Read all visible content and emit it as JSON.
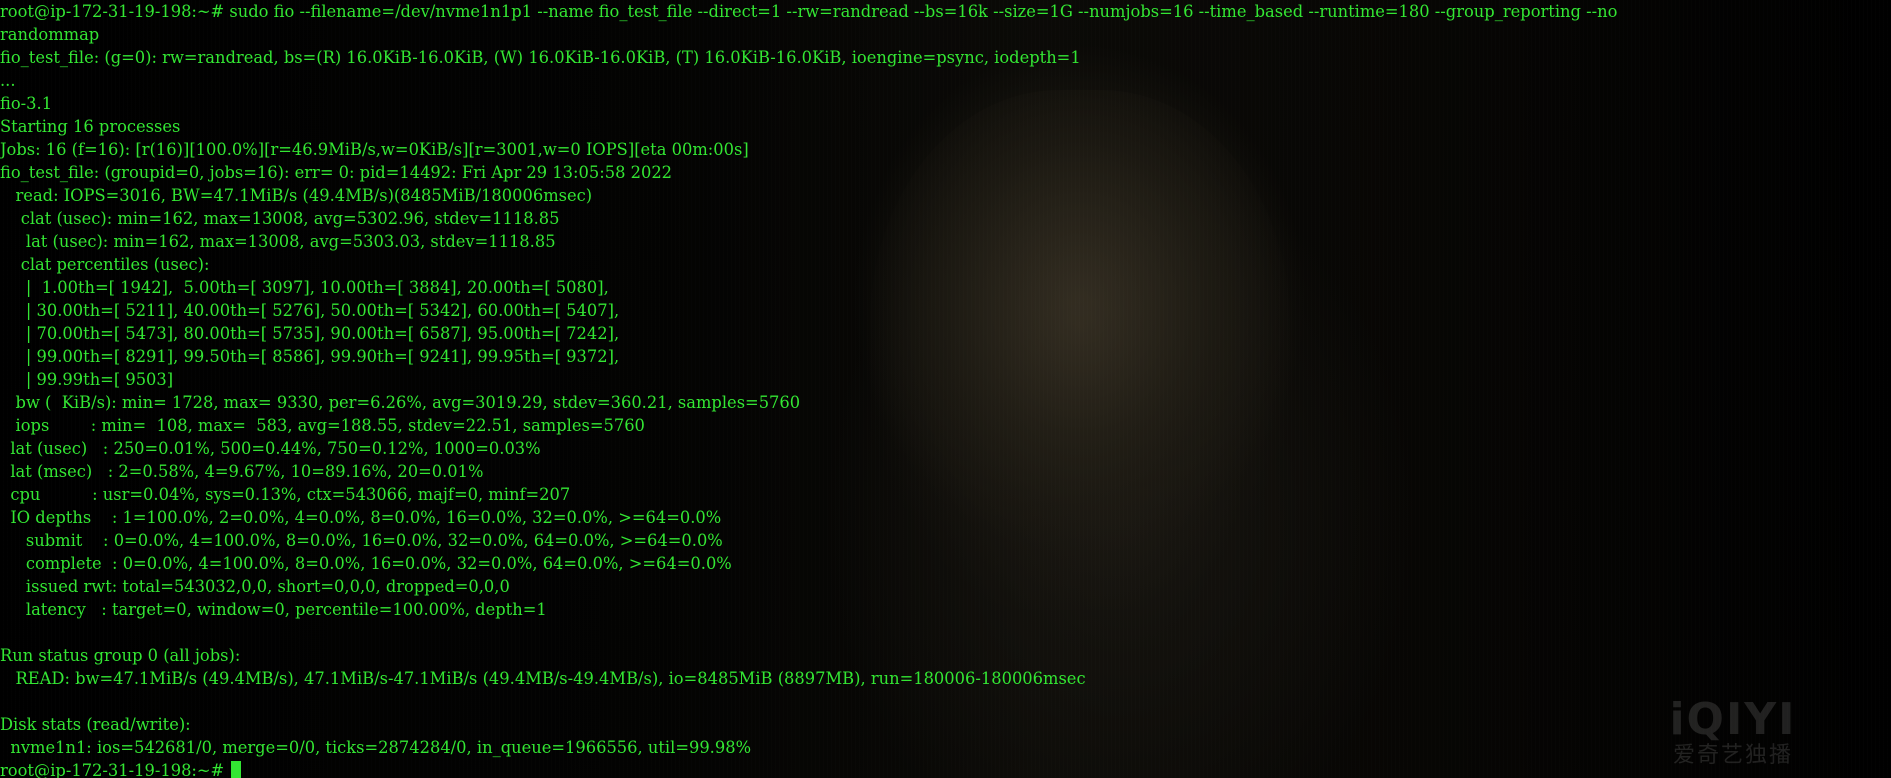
{
  "terminal": {
    "lines": [
      "root@ip-172-31-19-198:~# sudo fio --filename=/dev/nvme1n1p1 --name fio_test_file --direct=1 --rw=randread --bs=16k --size=1G --numjobs=16 --time_based --runtime=180 --group_reporting --no",
      "randommap",
      "fio_test_file: (g=0): rw=randread, bs=(R) 16.0KiB-16.0KiB, (W) 16.0KiB-16.0KiB, (T) 16.0KiB-16.0KiB, ioengine=psync, iodepth=1",
      "...",
      "fio-3.1",
      "Starting 16 processes",
      "Jobs: 16 (f=16): [r(16)][100.0%][r=46.9MiB/s,w=0KiB/s][r=3001,w=0 IOPS][eta 00m:00s]",
      "fio_test_file: (groupid=0, jobs=16): err= 0: pid=14492: Fri Apr 29 13:05:58 2022",
      "   read: IOPS=3016, BW=47.1MiB/s (49.4MB/s)(8485MiB/180006msec)",
      "    clat (usec): min=162, max=13008, avg=5302.96, stdev=1118.85",
      "     lat (usec): min=162, max=13008, avg=5303.03, stdev=1118.85",
      "    clat percentiles (usec):",
      "     |  1.00th=[ 1942],  5.00th=[ 3097], 10.00th=[ 3884], 20.00th=[ 5080],",
      "     | 30.00th=[ 5211], 40.00th=[ 5276], 50.00th=[ 5342], 60.00th=[ 5407],",
      "     | 70.00th=[ 5473], 80.00th=[ 5735], 90.00th=[ 6587], 95.00th=[ 7242],",
      "     | 99.00th=[ 8291], 99.50th=[ 8586], 99.90th=[ 9241], 99.95th=[ 9372],",
      "     | 99.99th=[ 9503]",
      "   bw (  KiB/s): min= 1728, max= 9330, per=6.26%, avg=3019.29, stdev=360.21, samples=5760",
      "   iops        : min=  108, max=  583, avg=188.55, stdev=22.51, samples=5760",
      "  lat (usec)   : 250=0.01%, 500=0.44%, 750=0.12%, 1000=0.03%",
      "  lat (msec)   : 2=0.58%, 4=9.67%, 10=89.16%, 20=0.01%",
      "  cpu          : usr=0.04%, sys=0.13%, ctx=543066, majf=0, minf=207",
      "  IO depths    : 1=100.0%, 2=0.0%, 4=0.0%, 8=0.0%, 16=0.0%, 32=0.0%, >=64=0.0%",
      "     submit    : 0=0.0%, 4=100.0%, 8=0.0%, 16=0.0%, 32=0.0%, 64=0.0%, >=64=0.0%",
      "     complete  : 0=0.0%, 4=100.0%, 8=0.0%, 16=0.0%, 32=0.0%, 64=0.0%, >=64=0.0%",
      "     issued rwt: total=543032,0,0, short=0,0,0, dropped=0,0,0",
      "     latency   : target=0, window=0, percentile=100.00%, depth=1",
      "",
      "Run status group 0 (all jobs):",
      "   READ: bw=47.1MiB/s (49.4MB/s), 47.1MiB/s-47.1MiB/s (49.4MB/s-49.4MB/s), io=8485MiB (8897MB), run=180006-180006msec",
      "",
      "Disk stats (read/write):",
      "  nvme1n1: ios=542681/0, merge=0/0, ticks=2874284/0, in_queue=1966556, util=99.98%"
    ],
    "prompt": "root@ip-172-31-19-198:~# "
  },
  "watermark": {
    "logo": "iQIYI",
    "subtitle": "爱奇艺独播"
  },
  "colors": {
    "text": "#33e633",
    "background": "#000000"
  }
}
